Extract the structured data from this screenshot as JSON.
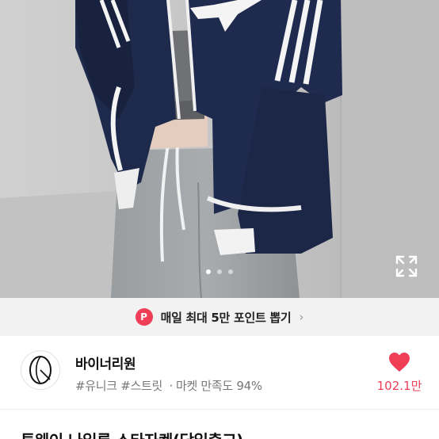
{
  "promo": {
    "badge": "P",
    "text": "매일 최대 5만 포인트 뽑기",
    "arrow": "›"
  },
  "carousel": {
    "dots": 3,
    "active_index": 0
  },
  "seller": {
    "name": "바이너리원",
    "tags": "#유니크 #스트릿",
    "sep": "·",
    "satisfaction": "마켓 만족도 94%"
  },
  "likes": {
    "count": "102.1만",
    "color": "#ef3e56"
  },
  "product": {
    "title": "투웨이 나일론 스타자켓(당일출고)"
  },
  "icons": {
    "expand": "expand-icon",
    "heart": "heart-icon",
    "logo": "seller-logo-icon",
    "point": "point-badge-icon"
  }
}
